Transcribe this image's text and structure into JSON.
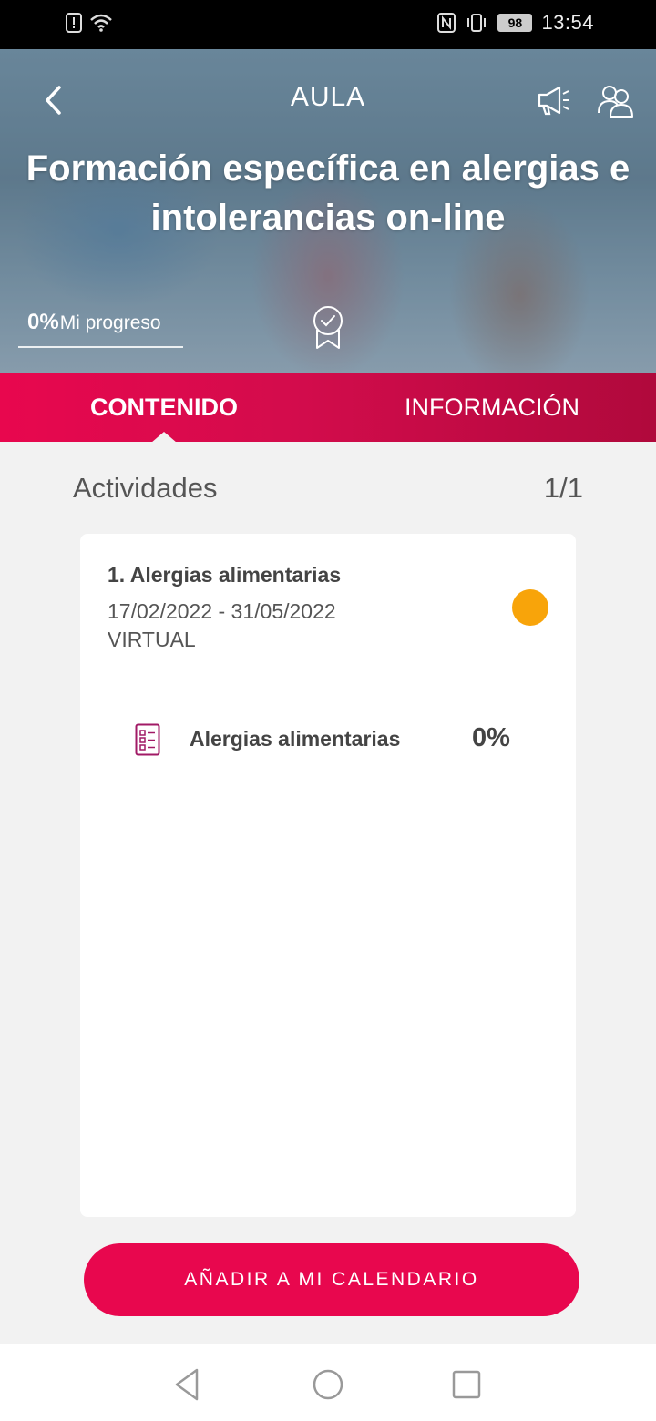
{
  "status_bar": {
    "time": "13:54",
    "battery": "98"
  },
  "header": {
    "title": "AULA",
    "back_icon": "chevron-left-icon",
    "megaphone_icon": "megaphone-icon",
    "users_icon": "users-icon"
  },
  "course": {
    "title": "Formación específica en alergias e intolerancias on-line",
    "progress_value": "0%",
    "progress_label": "Mi progreso",
    "badge_icon": "certificate-badge-icon"
  },
  "tabs": [
    {
      "label": "CONTENIDO",
      "active": true
    },
    {
      "label": "INFORMACIÓN",
      "active": false
    }
  ],
  "activities": {
    "heading": "Actividades",
    "count": "1/1",
    "items": [
      {
        "title": "1. Alergias alimentarias",
        "dates": "17/02/2022 - 31/05/2022",
        "mode": "VIRTUAL",
        "status_color": "#f8a40a",
        "resources": [
          {
            "label": "Alergias alimentarias",
            "progress": "0%",
            "icon": "checklist-icon"
          }
        ]
      }
    ]
  },
  "calendar_button": "AÑADIR A MI CALENDARIO",
  "colors": {
    "accent": "#e8074e",
    "accent_dark": "#b0093c",
    "status_pending": "#f8a40a"
  }
}
